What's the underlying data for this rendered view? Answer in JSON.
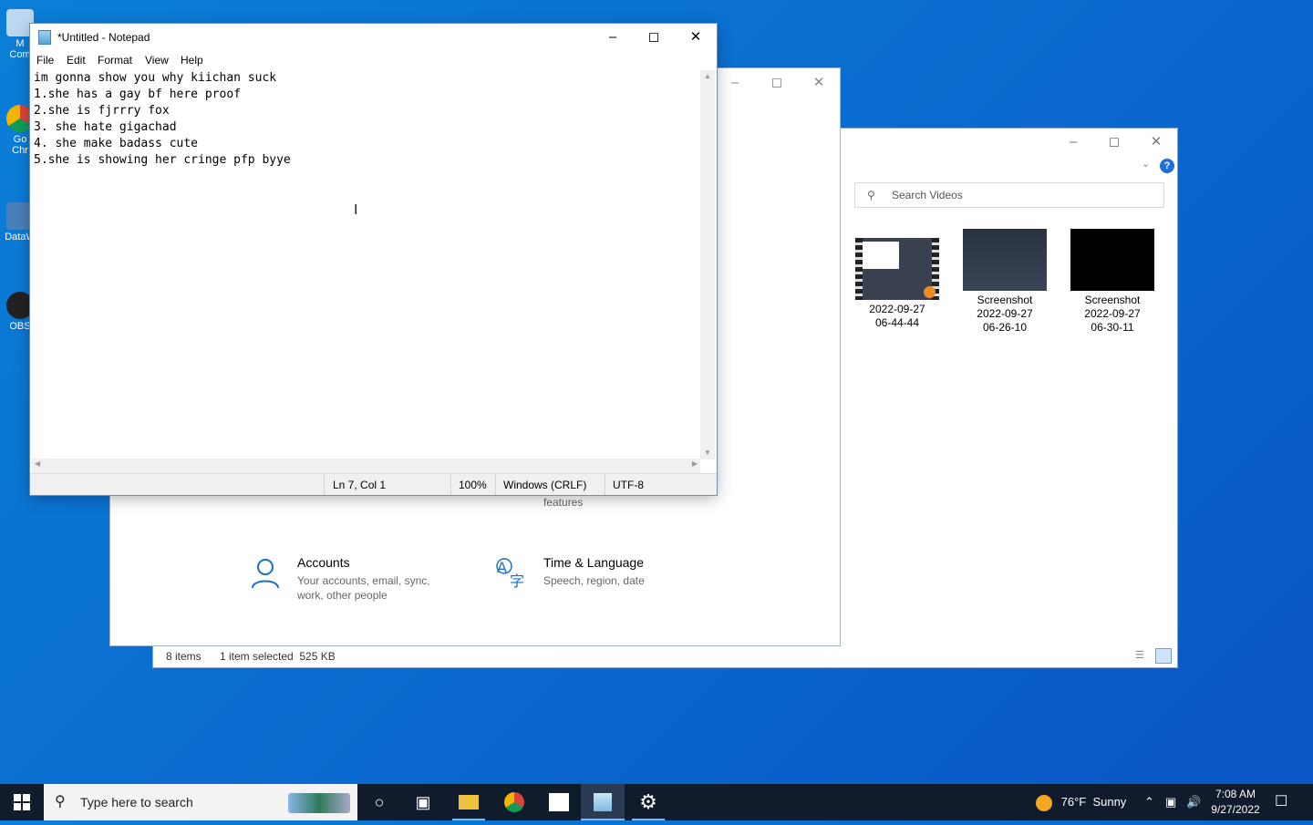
{
  "desktop": {
    "icons": [
      {
        "label": "M\nCom"
      },
      {
        "label": "Go\nChr"
      },
      {
        "label": "DataW"
      },
      {
        "label": "OBS"
      }
    ]
  },
  "explorer": {
    "search_placeholder": "Search Videos",
    "files": [
      {
        "name": "2022-09-27\n06-44-44"
      },
      {
        "name": "Screenshot\n2022-09-27\n06-26-10"
      },
      {
        "name": "Screenshot\n2022-09-27\n06-30-11"
      }
    ],
    "status": {
      "count": "8 items",
      "selected": "1 item selected  525 KB"
    }
  },
  "settings": {
    "partial_text": "features",
    "items": [
      {
        "title": "Accounts",
        "desc": "Your accounts, email, sync,\nwork, other people"
      },
      {
        "title": "Time & Language",
        "desc": "Speech, region, date"
      }
    ]
  },
  "notepad": {
    "title": "*Untitled - Notepad",
    "menu": [
      "File",
      "Edit",
      "Format",
      "View",
      "Help"
    ],
    "content": "im gonna show you why kiichan suck\n1.she has a gay bf here proof\n2.she is fjrrry fox\n3. she hate gigachad\n4. she make badass cute\n5.she is showing her cringe pfp byye\n",
    "status": {
      "position": "Ln 7, Col 1",
      "zoom": "100%",
      "line_ending": "Windows (CRLF)",
      "encoding": "UTF-8"
    }
  },
  "taskbar": {
    "search_placeholder": "Type here to search",
    "weather": "76°F  Sunny",
    "time": "7:08 AM",
    "date": "9/27/2022"
  }
}
